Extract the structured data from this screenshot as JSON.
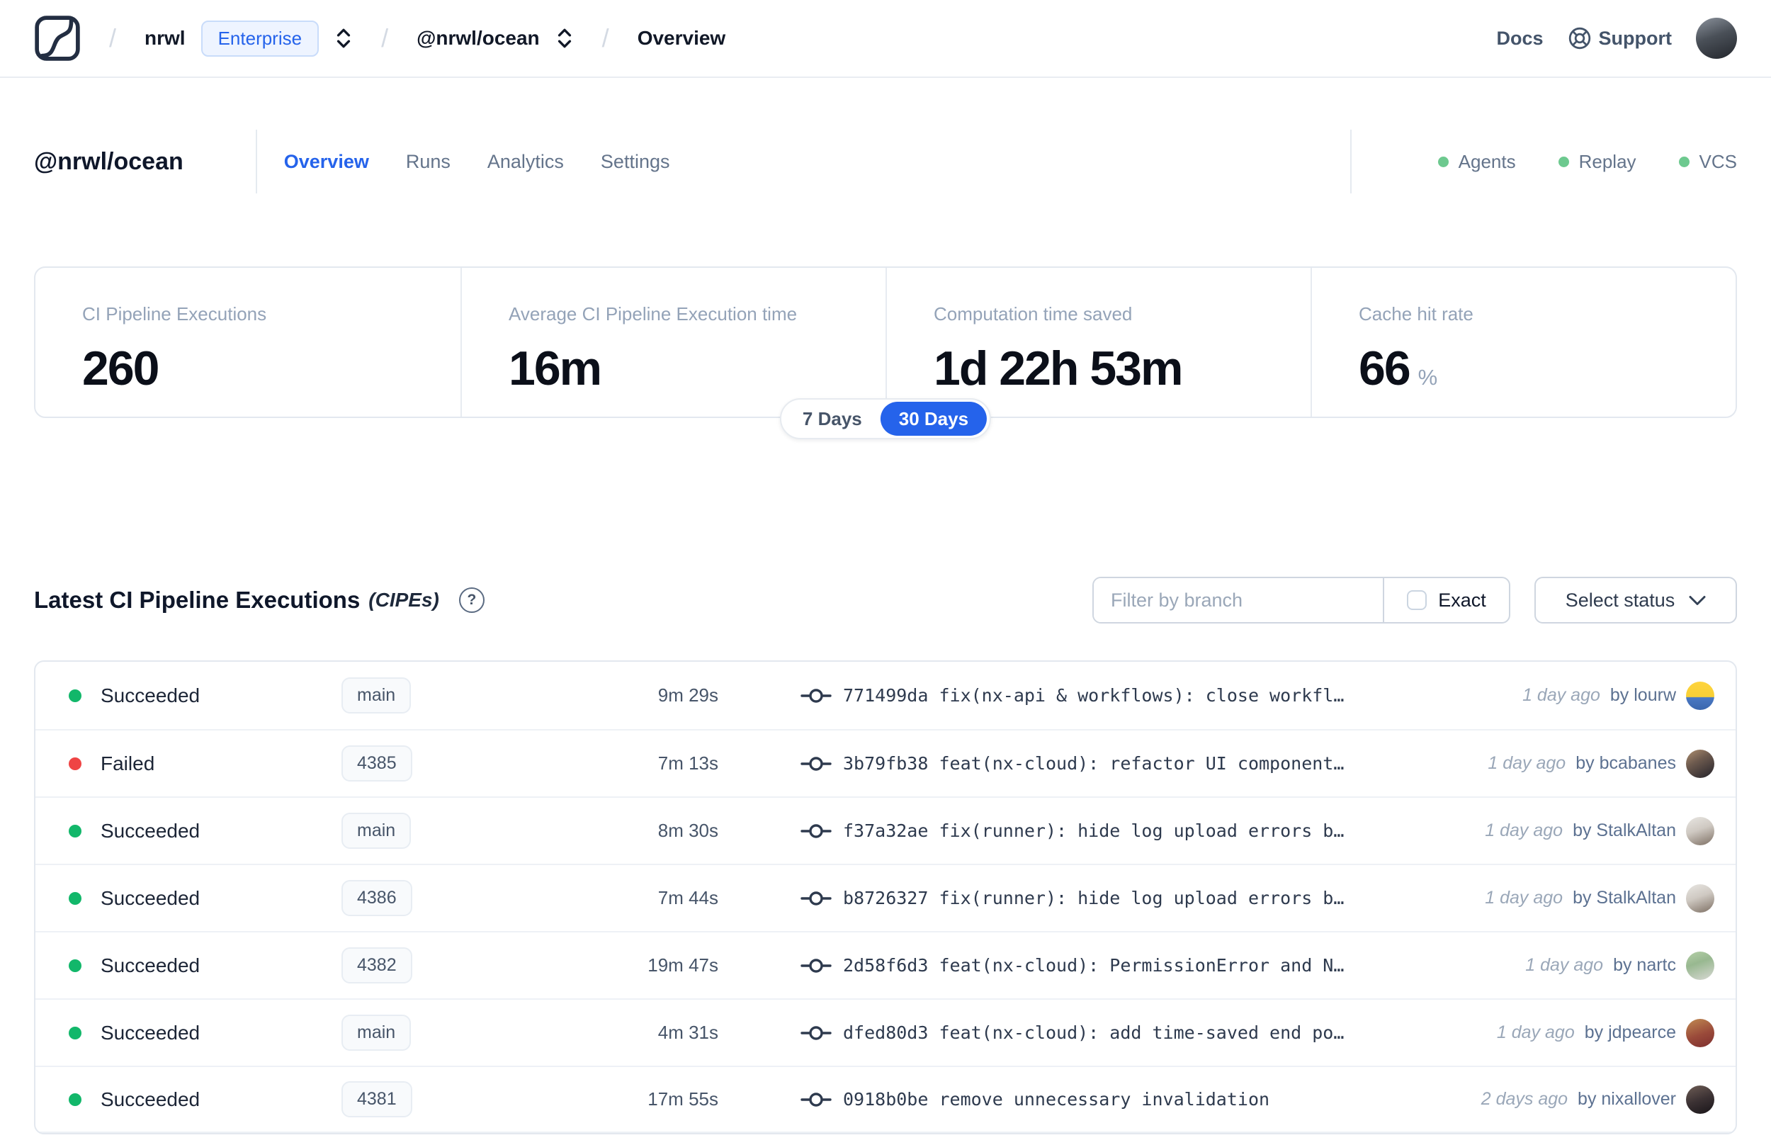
{
  "colors": {
    "accent": "#2563eb",
    "success": "#12b76a",
    "danger": "#ef4444",
    "dot": "#6dc98f"
  },
  "topnav": {
    "breadcrumb": {
      "org": "nrwl",
      "org_badge": "Enterprise",
      "workspace": "@nrwl/ocean",
      "page": "Overview"
    },
    "docs_label": "Docs",
    "support_label": "Support"
  },
  "workspace_header": {
    "title": "@nrwl/ocean",
    "tabs": [
      {
        "label": "Overview",
        "active": true
      },
      {
        "label": "Runs",
        "active": false
      },
      {
        "label": "Analytics",
        "active": false
      },
      {
        "label": "Settings",
        "active": false
      }
    ],
    "features": [
      {
        "label": "Agents"
      },
      {
        "label": "Replay"
      },
      {
        "label": "VCS"
      }
    ]
  },
  "stats": {
    "cards": [
      {
        "label": "CI Pipeline Executions",
        "value": "260",
        "unit": ""
      },
      {
        "label": "Average CI Pipeline Execution time",
        "value": "16m",
        "unit": ""
      },
      {
        "label": "Computation time saved",
        "value": "1d 22h 53m",
        "unit": ""
      },
      {
        "label": "Cache hit rate",
        "value": "66",
        "unit": "%"
      }
    ],
    "range_toggle": {
      "options": [
        "7 Days",
        "30 Days"
      ],
      "selected": "30 Days"
    }
  },
  "cipe_section": {
    "title": "Latest CI Pipeline Executions",
    "title_suffix": "(CIPEs)",
    "help_glyph": "?",
    "filter": {
      "branch_placeholder": "Filter by branch",
      "exact_label": "Exact",
      "status_label": "Select status"
    },
    "rows": [
      {
        "status": "Succeeded",
        "status_type": "succeeded",
        "branch": "main",
        "duration": "9m 29s",
        "commit": "771499da fix(nx-api & workflows): close workfl…",
        "time_ago": "1 day ago",
        "author": "by lourw"
      },
      {
        "status": "Failed",
        "status_type": "failed",
        "branch": "4385",
        "duration": "7m 13s",
        "commit": "3b79fb38 feat(nx-cloud): refactor UI component…",
        "time_ago": "1 day ago",
        "author": "by bcabanes"
      },
      {
        "status": "Succeeded",
        "status_type": "succeeded",
        "branch": "main",
        "duration": "8m 30s",
        "commit": "f37a32ae fix(runner): hide log upload errors b…",
        "time_ago": "1 day ago",
        "author": "by StalkAltan"
      },
      {
        "status": "Succeeded",
        "status_type": "succeeded",
        "branch": "4386",
        "duration": "7m 44s",
        "commit": "b8726327 fix(runner): hide log upload errors b…",
        "time_ago": "1 day ago",
        "author": "by StalkAltan"
      },
      {
        "status": "Succeeded",
        "status_type": "succeeded",
        "branch": "4382",
        "duration": "19m 47s",
        "commit": "2d58f6d3 feat(nx-cloud): PermissionError and N…",
        "time_ago": "1 day ago",
        "author": "by nartc"
      },
      {
        "status": "Succeeded",
        "status_type": "succeeded",
        "branch": "main",
        "duration": "4m 31s",
        "commit": "dfed80d3 feat(nx-cloud): add time-saved end po…",
        "time_ago": "1 day ago",
        "author": "by jdpearce"
      },
      {
        "status": "Succeeded",
        "status_type": "succeeded",
        "branch": "4381",
        "duration": "17m 55s",
        "commit": "0918b0be remove unnecessary invalidation",
        "time_ago": "2 days ago",
        "author": "by nixallover"
      }
    ]
  }
}
